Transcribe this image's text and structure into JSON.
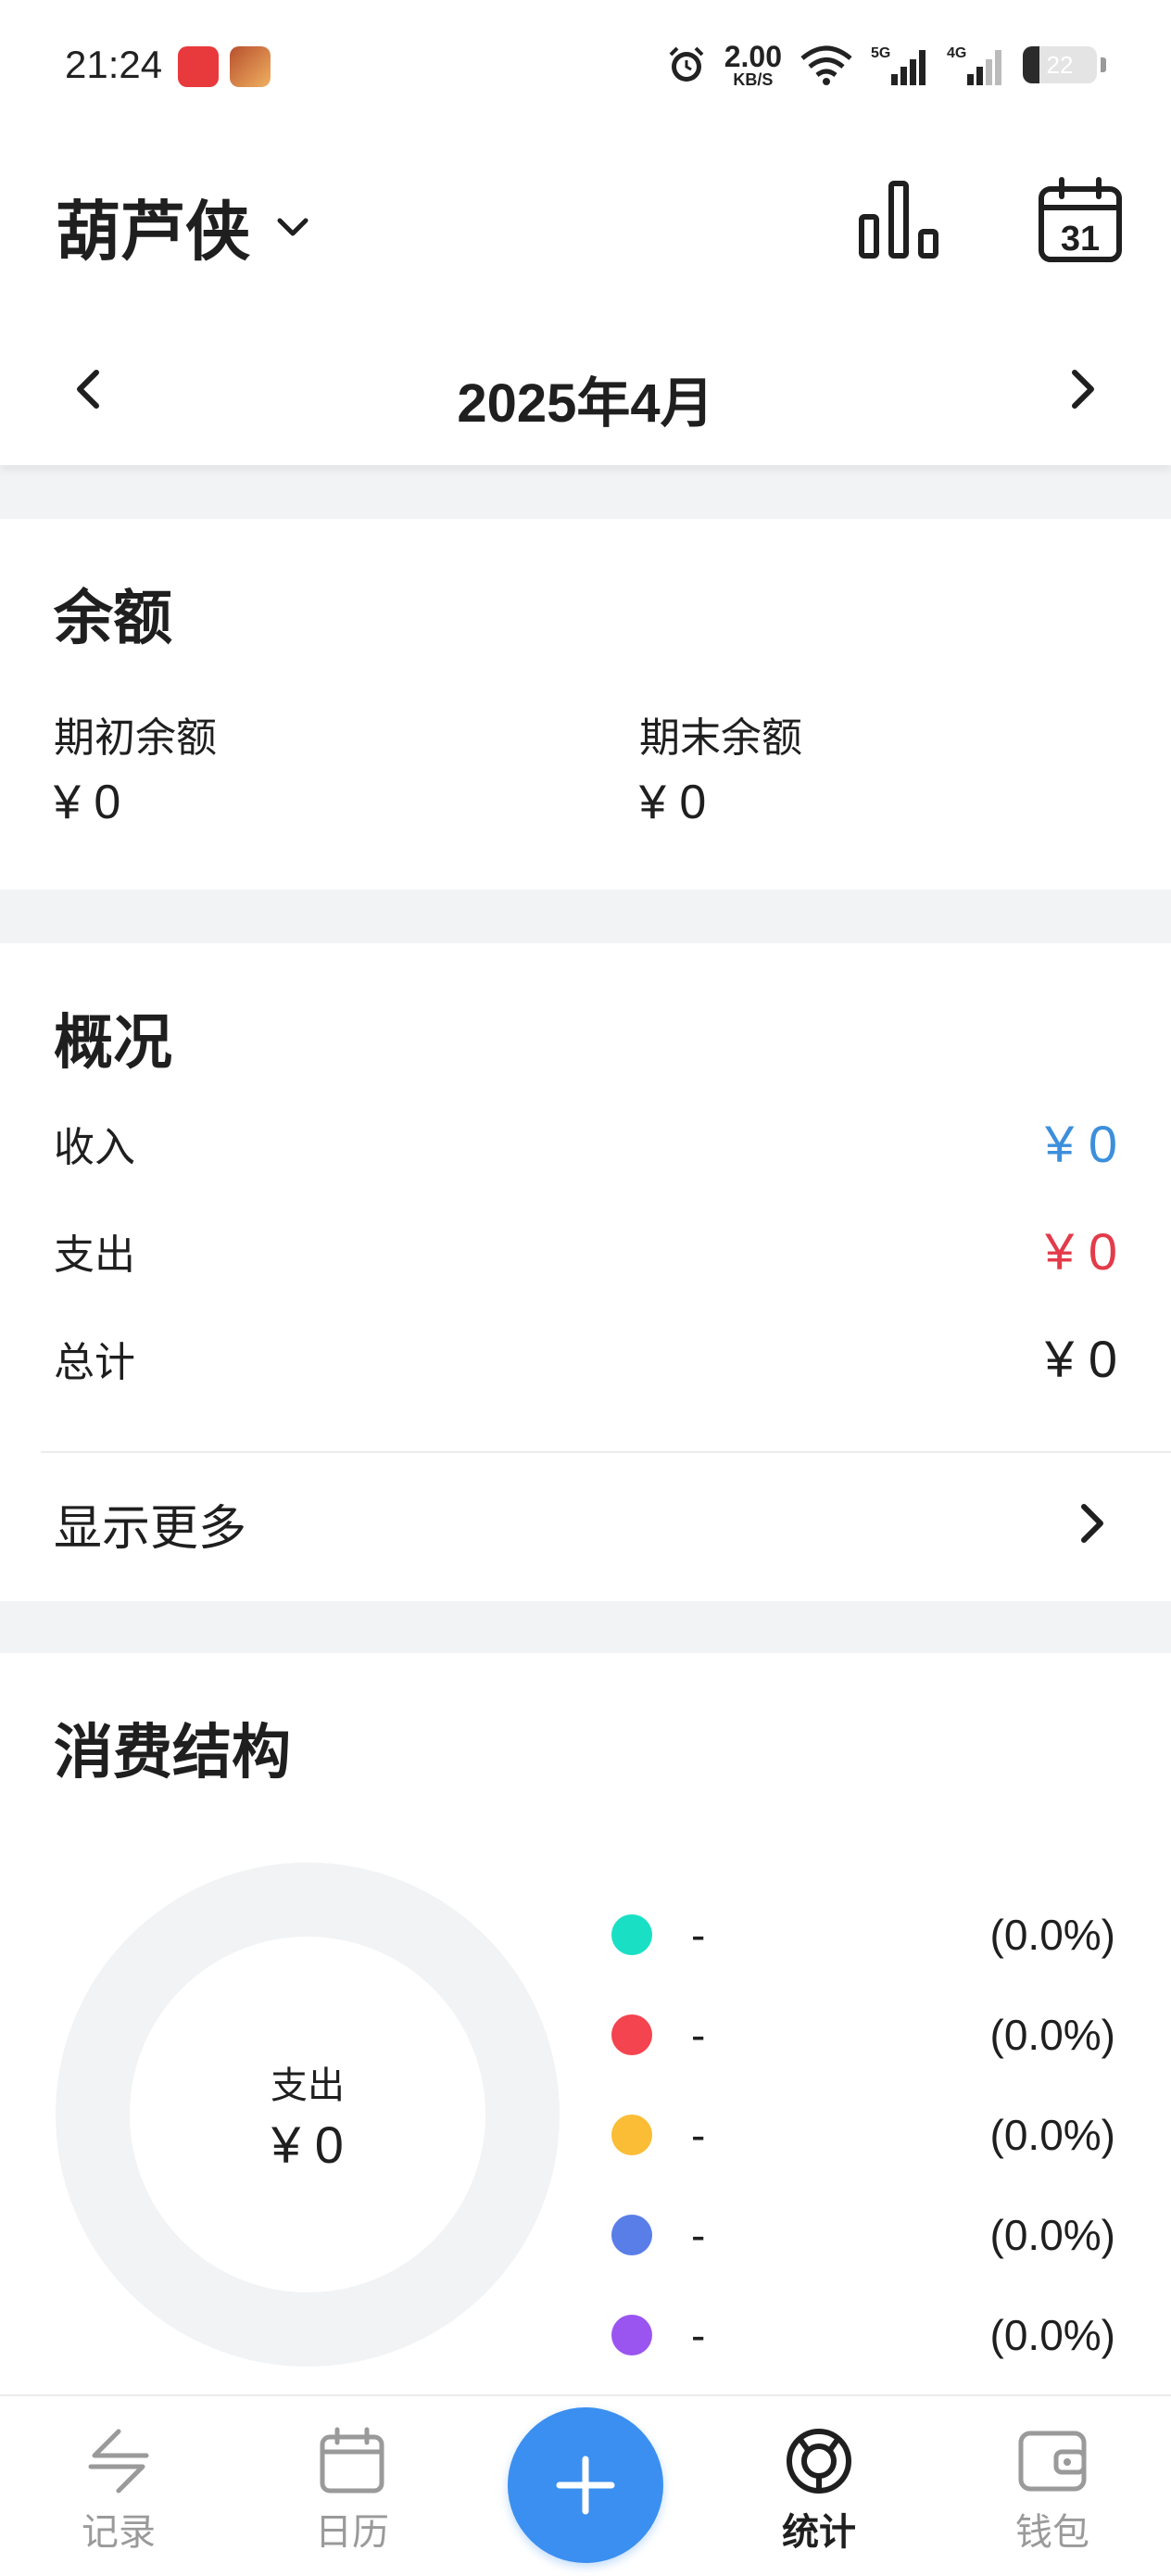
{
  "status_bar": {
    "time": "21:24",
    "net_speed_value": "2.00",
    "net_speed_unit": "KB/S",
    "signal1_label": "5G",
    "signal2_label": "4G",
    "battery": "22",
    "battery_level": 0.22
  },
  "header": {
    "book_name": "葫芦侠",
    "calendar_day": "31",
    "month_label": "2025年4月"
  },
  "balance": {
    "title": "余额",
    "opening_label": "期初余额",
    "opening_value": "¥ 0",
    "closing_label": "期末余额",
    "closing_value": "¥ 0"
  },
  "overview": {
    "title": "概况",
    "rows": [
      {
        "label": "收入",
        "value": "¥ 0",
        "color": "#3d8fdc"
      },
      {
        "label": "支出",
        "value": "¥ 0",
        "color": "#e33b4a"
      },
      {
        "label": "总计",
        "value": "¥ 0",
        "color": "#1f1f1f"
      }
    ],
    "more_label": "显示更多"
  },
  "structure": {
    "title": "消费结构",
    "center_label": "支出",
    "center_value": "¥ 0",
    "legend": [
      {
        "name": "-",
        "pct": "(0.0%)",
        "color": "#19e0c5"
      },
      {
        "name": "-",
        "pct": "(0.0%)",
        "color": "#f4444f"
      },
      {
        "name": "-",
        "pct": "(0.0%)",
        "color": "#fbbd35"
      },
      {
        "name": "-",
        "pct": "(0.0%)",
        "color": "#5a7ee8"
      },
      {
        "name": "-",
        "pct": "(0.0%)",
        "color": "#9a55f0"
      }
    ]
  },
  "bottom_nav": {
    "items": [
      {
        "label": "记录",
        "icon": "swap-arrows-icon"
      },
      {
        "label": "日历",
        "icon": "calendar-icon"
      },
      {
        "label": "统计",
        "icon": "stats-ring-icon"
      },
      {
        "label": "钱包",
        "icon": "wallet-icon"
      }
    ],
    "fab_icon": "plus-icon",
    "accent": "#3b8ff0"
  }
}
